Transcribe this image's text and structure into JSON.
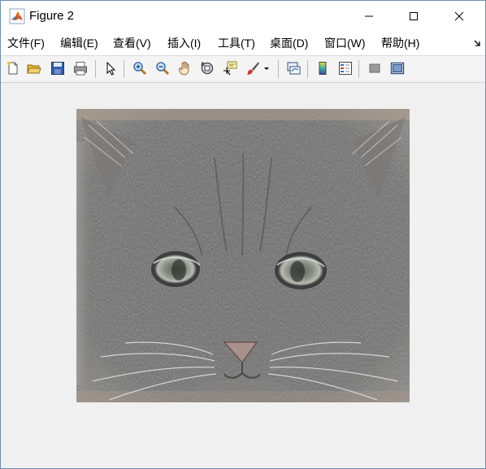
{
  "window": {
    "title": "Figure 2",
    "controls": {
      "minimize": "minimize",
      "maximize": "maximize",
      "close": "close"
    }
  },
  "menu": {
    "items": [
      {
        "label": "文件(F)"
      },
      {
        "label": "编辑(E)"
      },
      {
        "label": "查看(V)"
      },
      {
        "label": "插入(I)"
      },
      {
        "label": "工具(T)"
      },
      {
        "label": "桌面(D)"
      },
      {
        "label": "窗口(W)"
      },
      {
        "label": "帮助(H)"
      }
    ]
  },
  "toolbar": {
    "buttons": [
      {
        "icon": "new-figure-icon"
      },
      {
        "icon": "open-file-icon"
      },
      {
        "icon": "save-icon"
      },
      {
        "icon": "print-icon"
      },
      {
        "icon": "edit-plot-arrow-icon"
      },
      {
        "icon": "zoom-in-icon"
      },
      {
        "icon": "zoom-out-icon"
      },
      {
        "icon": "pan-hand-icon"
      },
      {
        "icon": "rotate-3d-icon"
      },
      {
        "icon": "data-cursor-icon"
      },
      {
        "icon": "brush-icon"
      },
      {
        "icon": "link-plot-icon"
      },
      {
        "icon": "colorbar-icon"
      },
      {
        "icon": "legend-icon"
      },
      {
        "icon": "hide-plot-tools-icon"
      },
      {
        "icon": "show-plot-tools-icon"
      }
    ]
  },
  "figure": {
    "content": "kitten face image (high-pass filtered)",
    "colors": {
      "image_base": "#6f6f6f",
      "canvas": "#f0f0f0",
      "titlebar": "#ffffff"
    }
  }
}
